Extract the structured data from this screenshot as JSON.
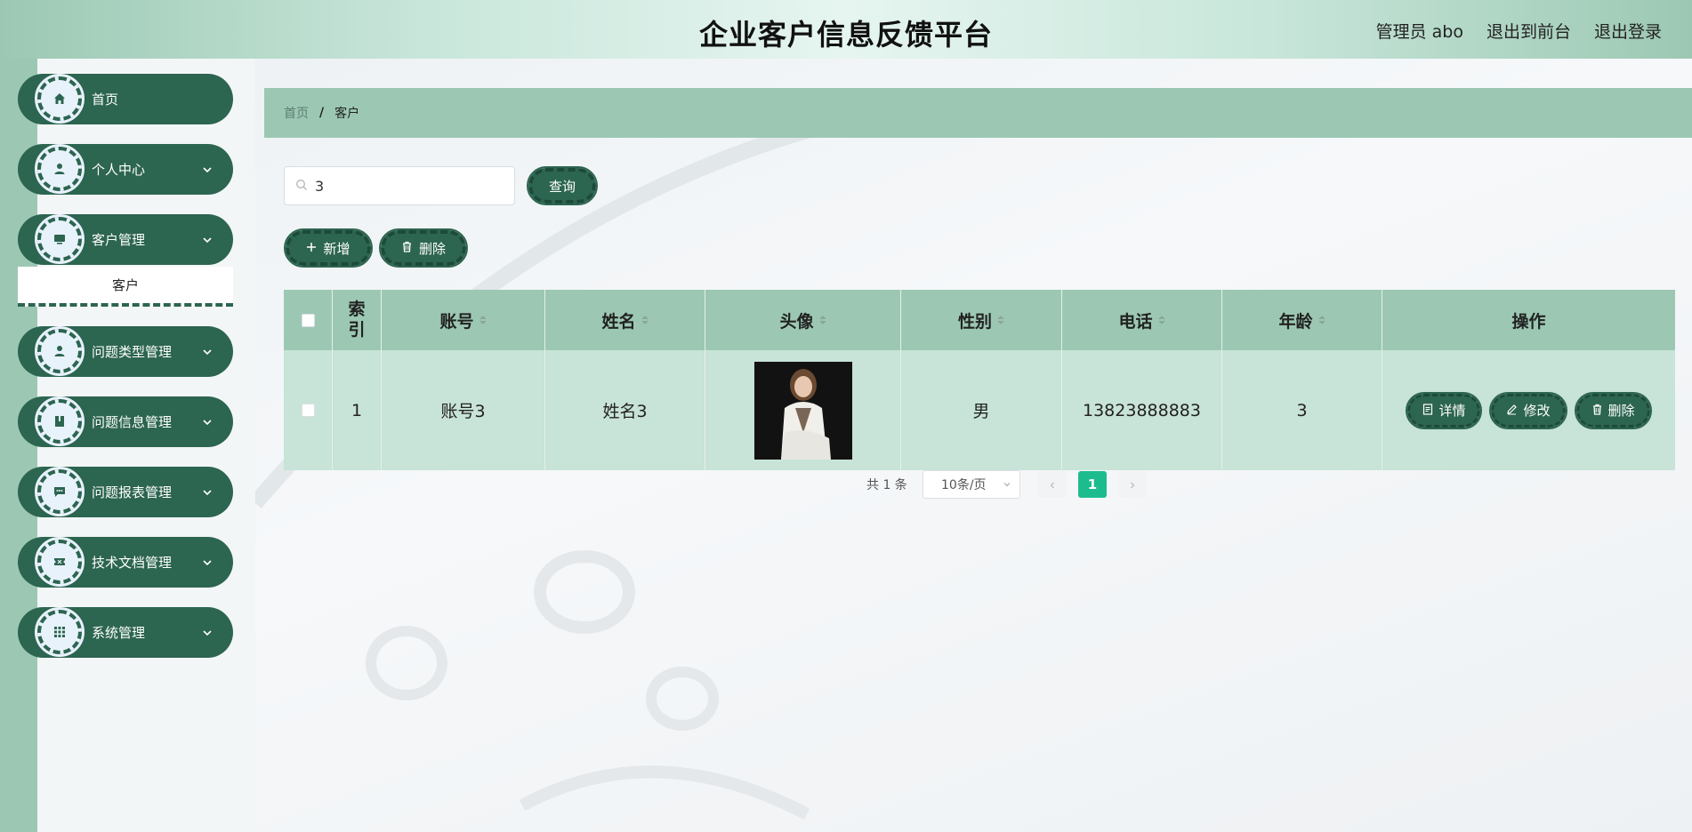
{
  "header": {
    "title": "企业客户信息反馈平台",
    "admin_label": "管理员 abo",
    "to_front_label": "退出到前台",
    "logout_label": "退出登录"
  },
  "sidebar": {
    "items": [
      {
        "label": "首页",
        "icon": "home-icon"
      },
      {
        "label": "个人中心",
        "icon": "user-icon"
      },
      {
        "label": "客户管理",
        "icon": "monitor-icon"
      },
      {
        "label": "问题类型管理",
        "icon": "user-icon"
      },
      {
        "label": "问题信息管理",
        "icon": "book-icon"
      },
      {
        "label": "问题报表管理",
        "icon": "chat-icon"
      },
      {
        "label": "技术文档管理",
        "icon": "ticket-icon"
      },
      {
        "label": "系统管理",
        "icon": "grid-icon"
      }
    ],
    "submenu_label": "客户"
  },
  "breadcrumb": {
    "home": "首页",
    "separator": "/",
    "current": "客户"
  },
  "search": {
    "value": "3",
    "button_label": "查询"
  },
  "toolbar": {
    "add_label": "新增",
    "delete_label": "删除"
  },
  "table": {
    "headers": [
      "索引",
      "账号",
      "姓名",
      "头像",
      "性别",
      "电话",
      "年龄",
      "操作"
    ],
    "rows": [
      {
        "index": "1",
        "account": "账号3",
        "name": "姓名3",
        "gender": "男",
        "phone": "13823888883",
        "age": "3"
      }
    ],
    "actions": {
      "detail": "详情",
      "edit": "修改",
      "delete": "删除"
    }
  },
  "pagination": {
    "total": "共 1 条",
    "page_size": "10条/页",
    "current_page": "1"
  },
  "colors": {
    "primary": "#2c6550",
    "header_bg": "#9cc8b3",
    "row_bg": "#c8e3d7",
    "active_page": "#1dbc8f"
  }
}
